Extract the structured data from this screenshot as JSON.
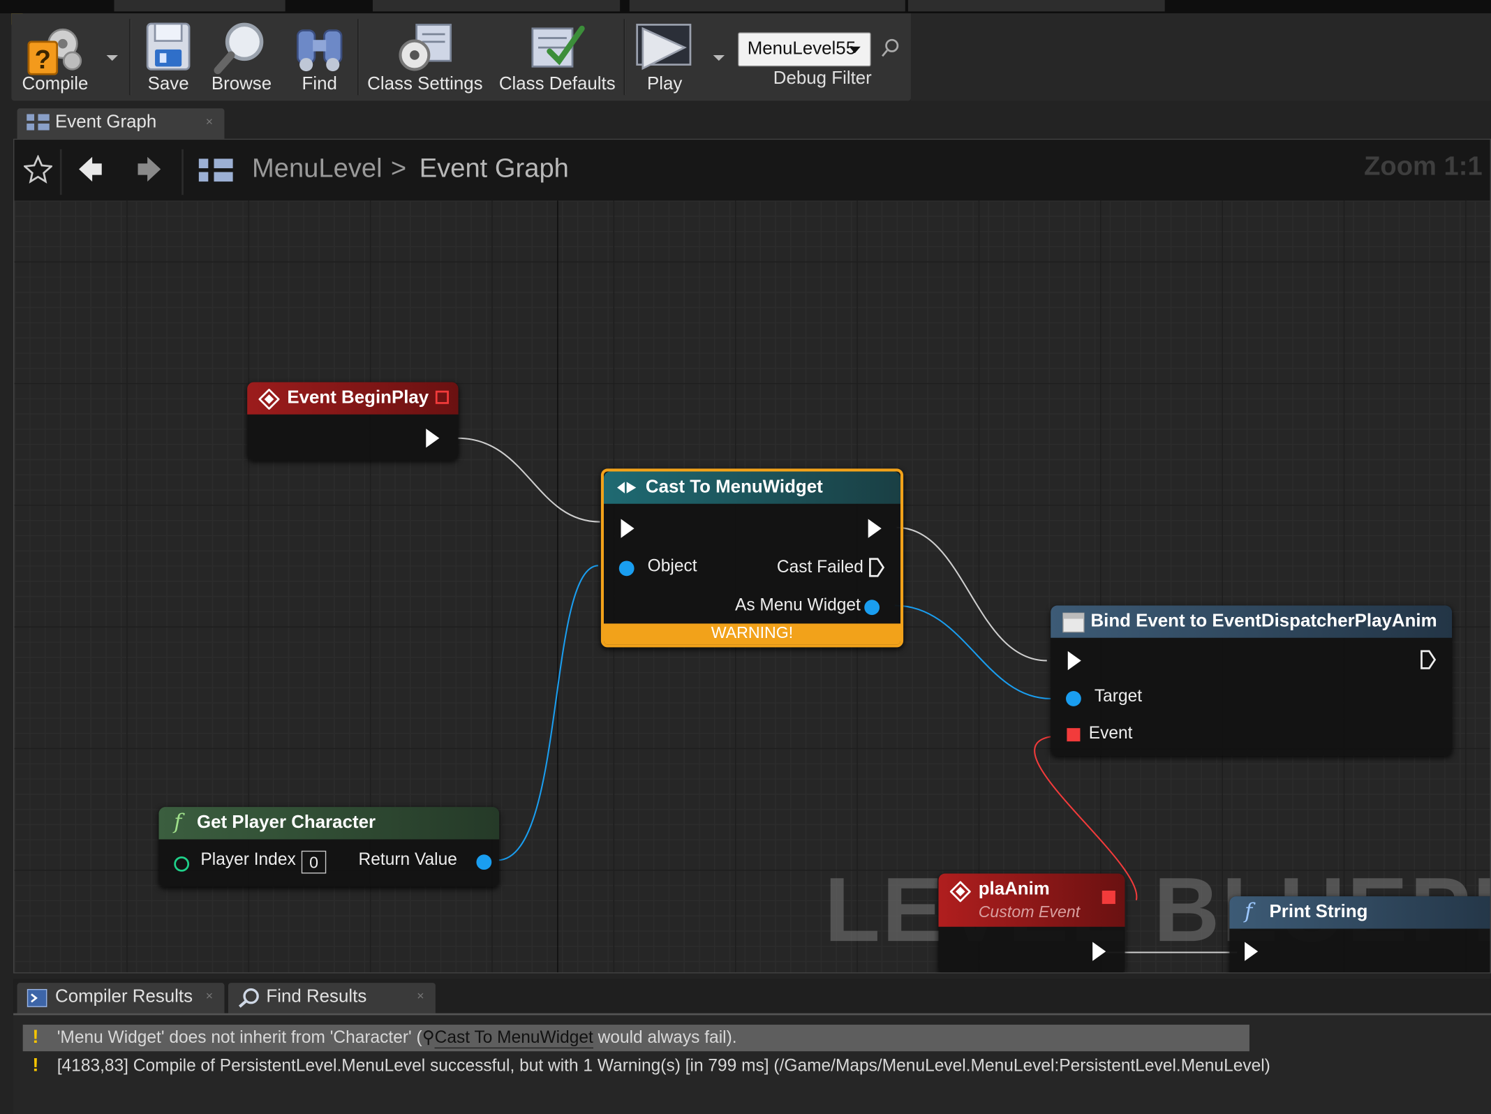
{
  "toolbar": {
    "compile": "Compile",
    "save": "Save",
    "browse": "Browse",
    "find": "Find",
    "class_settings": "Class Settings",
    "class_defaults": "Class Defaults",
    "play": "Play",
    "debug_selected": "MenuLevel55",
    "debug_filter": "Debug Filter"
  },
  "editor_tab": {
    "label": "Event Graph"
  },
  "breadcrumb": {
    "root": "MenuLevel",
    "separator": ">",
    "leaf": "Event Graph",
    "zoom": "Zoom 1:1"
  },
  "watermark": "LEVEL BLUEPRINT",
  "nodes": {
    "begin_play": {
      "title": "Event BeginPlay"
    },
    "cast": {
      "title": "Cast To MenuWidget",
      "pin_object": "Object",
      "pin_cast_failed": "Cast Failed",
      "pin_as": "As Menu Widget",
      "warning": "WARNING!"
    },
    "bind": {
      "title": "Bind Event to EventDispatcherPlayAnim",
      "pin_target": "Target",
      "pin_event": "Event"
    },
    "get_player": {
      "title": "Get Player Character",
      "pin_index": "Player Index",
      "index_value": "0",
      "pin_return": "Return Value"
    },
    "pla_anim": {
      "title": "plaAnim",
      "subtitle": "Custom Event"
    },
    "print_string": {
      "title": "Print String"
    }
  },
  "bottom_tabs": [
    "Compiler Results",
    "Find Results"
  ],
  "log": {
    "line1_pre": "'Menu Widget' does not inherit from 'Character' (",
    "line1_link": "Cast To MenuWidget",
    "line1_post": " would always fail).",
    "line2": "[4183,83] Compile of PersistentLevel.MenuLevel successful, but with 1 Warning(s) [in 799 ms] (/Game/Maps/MenuLevel.MenuLevel:PersistentLevel.MenuLevel)"
  },
  "colors": {
    "event_header": "#8a1a1a",
    "cast_header": "#1f5f66",
    "function_header": "#2f4a33",
    "warning": "#f2a21a",
    "object_pin": "#1a9ef0",
    "delegate_pin": "#f23b3b"
  }
}
